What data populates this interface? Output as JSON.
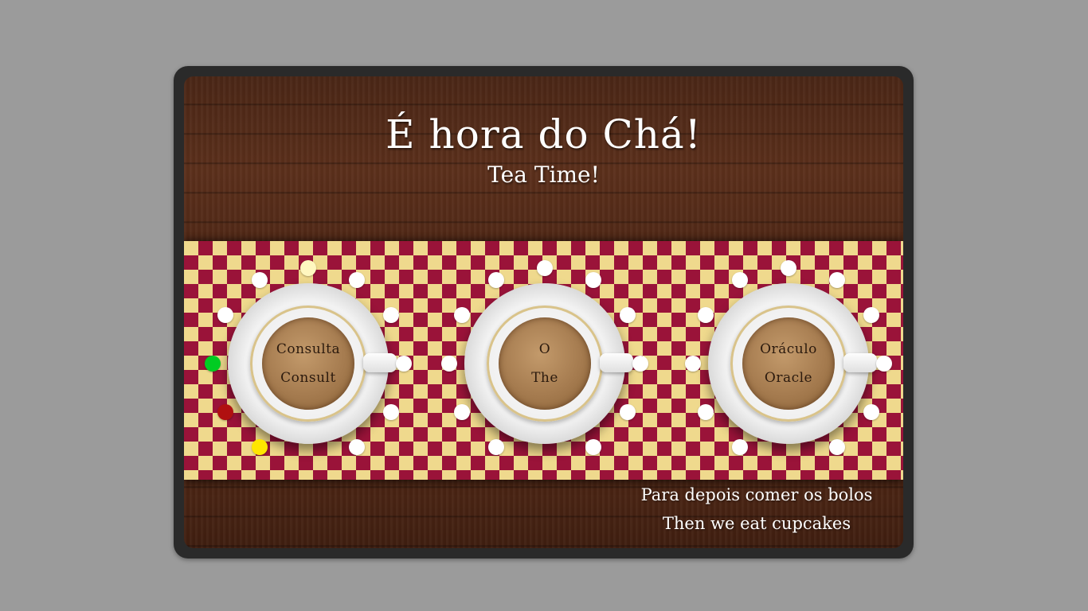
{
  "header": {
    "title": "É hora do Chá!",
    "subtitle": "Tea Time!"
  },
  "cups": [
    {
      "line1": "Consulta",
      "line2": "Consult"
    },
    {
      "line1": "O",
      "line2": "The"
    },
    {
      "line1": "Oráculo",
      "line2": "Oracle"
    }
  ],
  "footer": {
    "line1": "Para depois comer os bolos",
    "line2": "Then we eat cupcakes"
  },
  "colors": {
    "wood": "#4a2616",
    "runner_red": "#9a1339",
    "runner_gold": "#efd98d",
    "dot_white": "#ffffff",
    "dot_green": "#00cc22",
    "dot_red": "#b01010",
    "dot_yellow": "#ffe600",
    "dot_cream": "#fff7c0"
  },
  "status_dots": {
    "green": "green",
    "red": "red",
    "yellow": "yellow",
    "cream": "cream"
  }
}
